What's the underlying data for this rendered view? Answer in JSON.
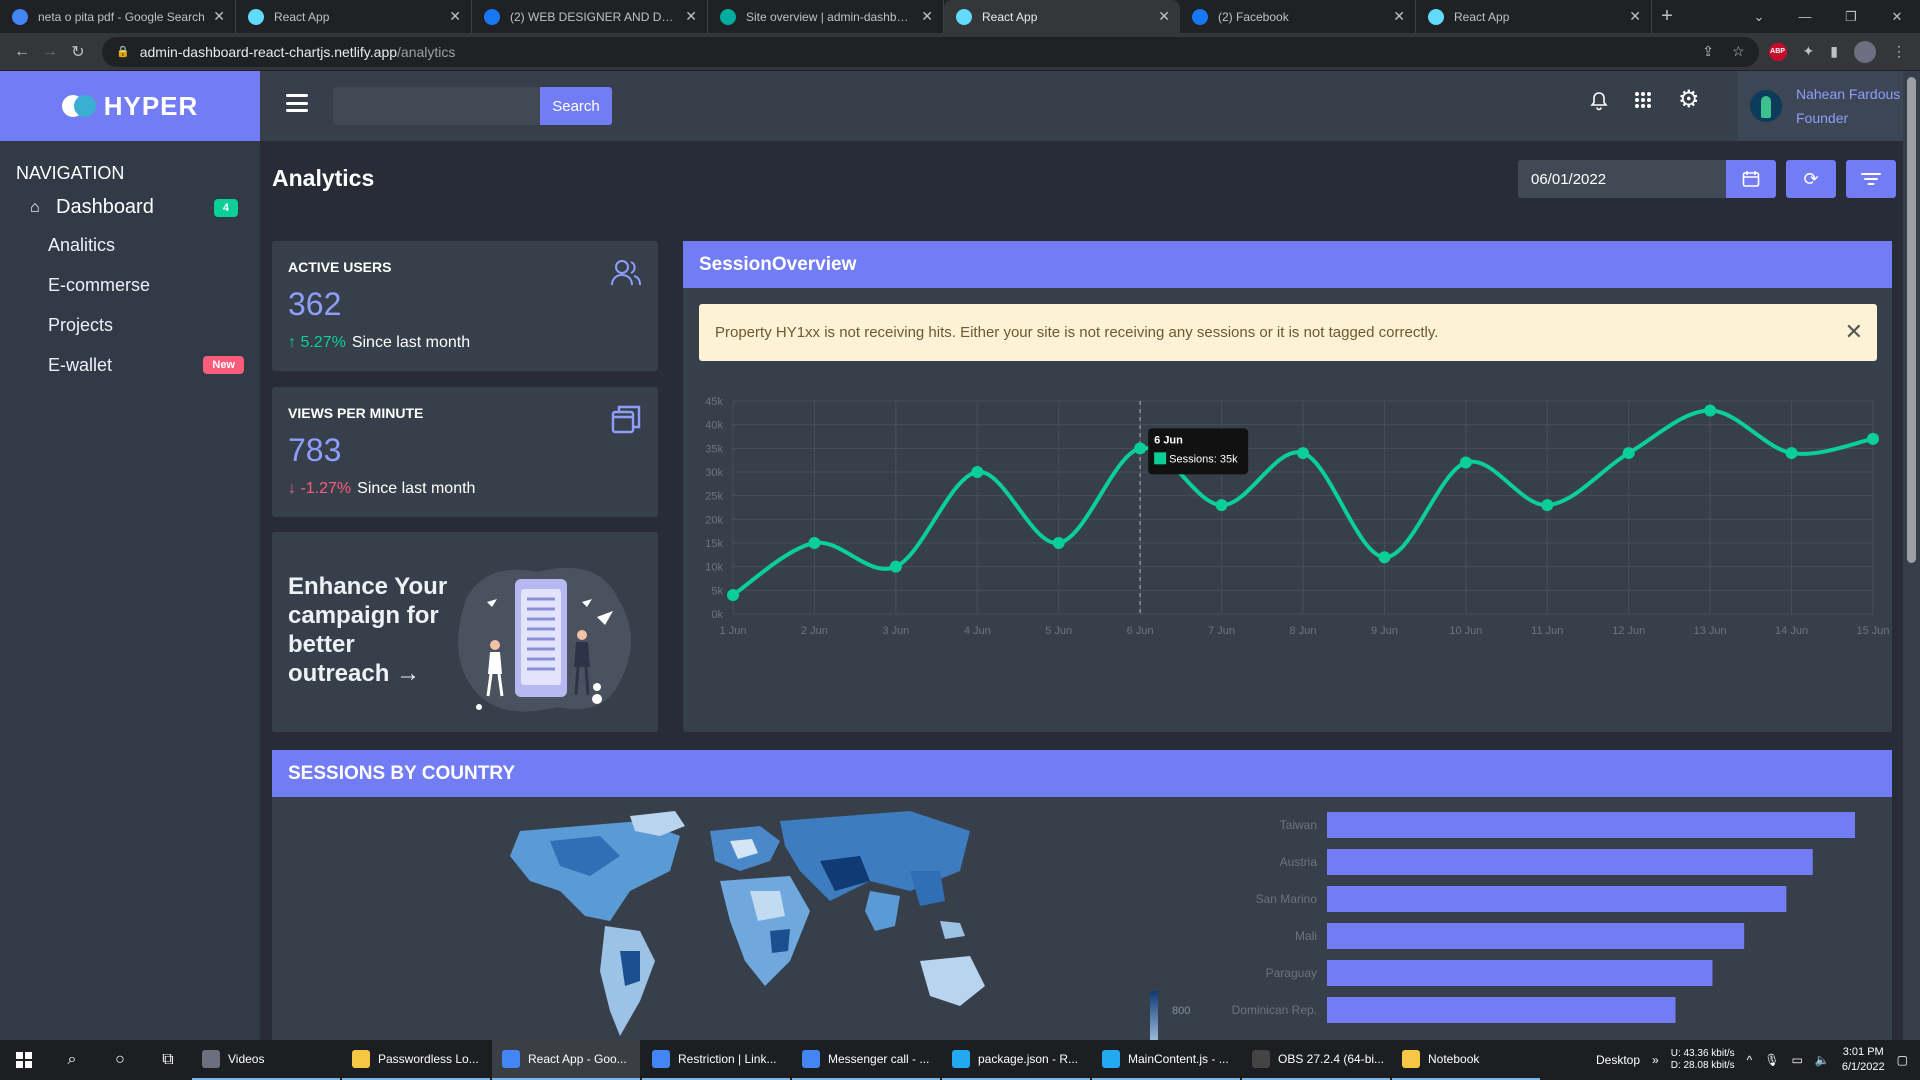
{
  "browser": {
    "tabs": [
      {
        "title": "neta o pita pdf - Google Search",
        "icon": "google-icon",
        "color": "#4285f4",
        "active": false
      },
      {
        "title": "React App",
        "icon": "react-icon",
        "color": "#61dafb",
        "active": false
      },
      {
        "title": "(2) WEB DESIGNER AND DEVELO",
        "icon": "facebook-icon",
        "color": "#1877f2",
        "active": false
      },
      {
        "title": "Site overview | admin-dashboard",
        "icon": "netlify-icon",
        "color": "#00ad9f",
        "active": false
      },
      {
        "title": "React App",
        "icon": "react-icon",
        "color": "#61dafb",
        "active": true
      },
      {
        "title": "(2) Facebook",
        "icon": "facebook-icon",
        "color": "#1877f2",
        "active": false
      },
      {
        "title": "React App",
        "icon": "react-icon",
        "color": "#61dafb",
        "active": false
      }
    ],
    "url_host": "admin-dashboard-react-chartjs.netlify.app",
    "url_path": "/analytics"
  },
  "brand": {
    "name": "HYPER"
  },
  "sidebar": {
    "title": "NAVIGATION",
    "dashboard": {
      "label": "Dashboard",
      "badge": "4"
    },
    "items": [
      {
        "label": "Analitics"
      },
      {
        "label": "E-commerse"
      },
      {
        "label": "Projects"
      },
      {
        "label": "E-wallet",
        "badge": "New"
      }
    ]
  },
  "topbar": {
    "search_button": "Search",
    "search_placeholder": "",
    "user_name": "Nahean Fardous",
    "user_role": "Founder"
  },
  "page": {
    "title": "Analytics",
    "date_value": "06/01/2022"
  },
  "stats": {
    "active_users": {
      "label": "ACTIVE USERS",
      "value": "362",
      "trend": "5.27%",
      "trend_dir": "up",
      "since": "Since last month"
    },
    "views": {
      "label": "VIEWS PER MINUTE",
      "value": "783",
      "trend": "-1.27%",
      "trend_dir": "down",
      "since": "Since last month"
    }
  },
  "promo": {
    "text": "Enhance Your campaign for better outreach →"
  },
  "session": {
    "title": "SessionOverview",
    "alert": "Property HY1xx is not receiving hits. Either your site is not receiving any sessions or it is not tagged correctly."
  },
  "countries": {
    "title": "SESSIONS BY COUNTRY",
    "legend_value": "800"
  },
  "chart_data": [
    {
      "type": "line",
      "title": "SessionOverview",
      "x": [
        "1 Jun",
        "2 Jun",
        "3 Jun",
        "4 Jun",
        "5 Jun",
        "6 Jun",
        "7 Jun",
        "8 Jun",
        "9 Jun",
        "10 Jun",
        "11 Jun",
        "12 Jun",
        "13 Jun",
        "14 Jun",
        "15 Jun"
      ],
      "series": [
        {
          "name": "Sessions",
          "values": [
            4000,
            15000,
            10000,
            30000,
            15000,
            35000,
            23000,
            34000,
            12000,
            32000,
            23000,
            34000,
            43000,
            34000,
            37000
          ]
        }
      ],
      "y_ticks": [
        "0k",
        "5k",
        "10k",
        "15k",
        "20k",
        "25k",
        "30k",
        "35k",
        "40k",
        "45k"
      ],
      "ylim": [
        0,
        45000
      ],
      "color": "#0acf97",
      "tooltip": {
        "title": "6 Jun",
        "label": "Sessions: 35k"
      },
      "grid": true
    },
    {
      "type": "bar",
      "title": "SESSIONS BY COUNTRY",
      "orientation": "horizontal",
      "categories": [
        "Taiwan",
        "Austria",
        "San Marino",
        "Mali",
        "Paraguay",
        "Dominican Rep."
      ],
      "values": [
        100,
        92,
        87,
        79,
        73,
        66
      ],
      "color": "#727cf5"
    }
  ],
  "taskbar": {
    "apps": [
      {
        "label": "Videos",
        "color": "#6b6f80"
      },
      {
        "label": "Passwordless Lo...",
        "color": "#f6c744"
      },
      {
        "label": "React App - Goo...",
        "color": "#4285f4",
        "active": true
      },
      {
        "label": "Restriction | Link...",
        "color": "#4285f4"
      },
      {
        "label": "Messenger call - ...",
        "color": "#4285f4"
      },
      {
        "label": "package.json - R...",
        "color": "#23a9f2"
      },
      {
        "label": "MainContent.js - ...",
        "color": "#23a9f2"
      },
      {
        "label": "OBS 27.2.4 (64-bi...",
        "color": "#444"
      },
      {
        "label": "Notebook",
        "color": "#f6c744"
      }
    ],
    "desktop": "Desktop",
    "upload": "43.36 kbit/s",
    "download": "28.08 kbit/s",
    "time": "3:01 PM",
    "date": "6/1/2022"
  }
}
